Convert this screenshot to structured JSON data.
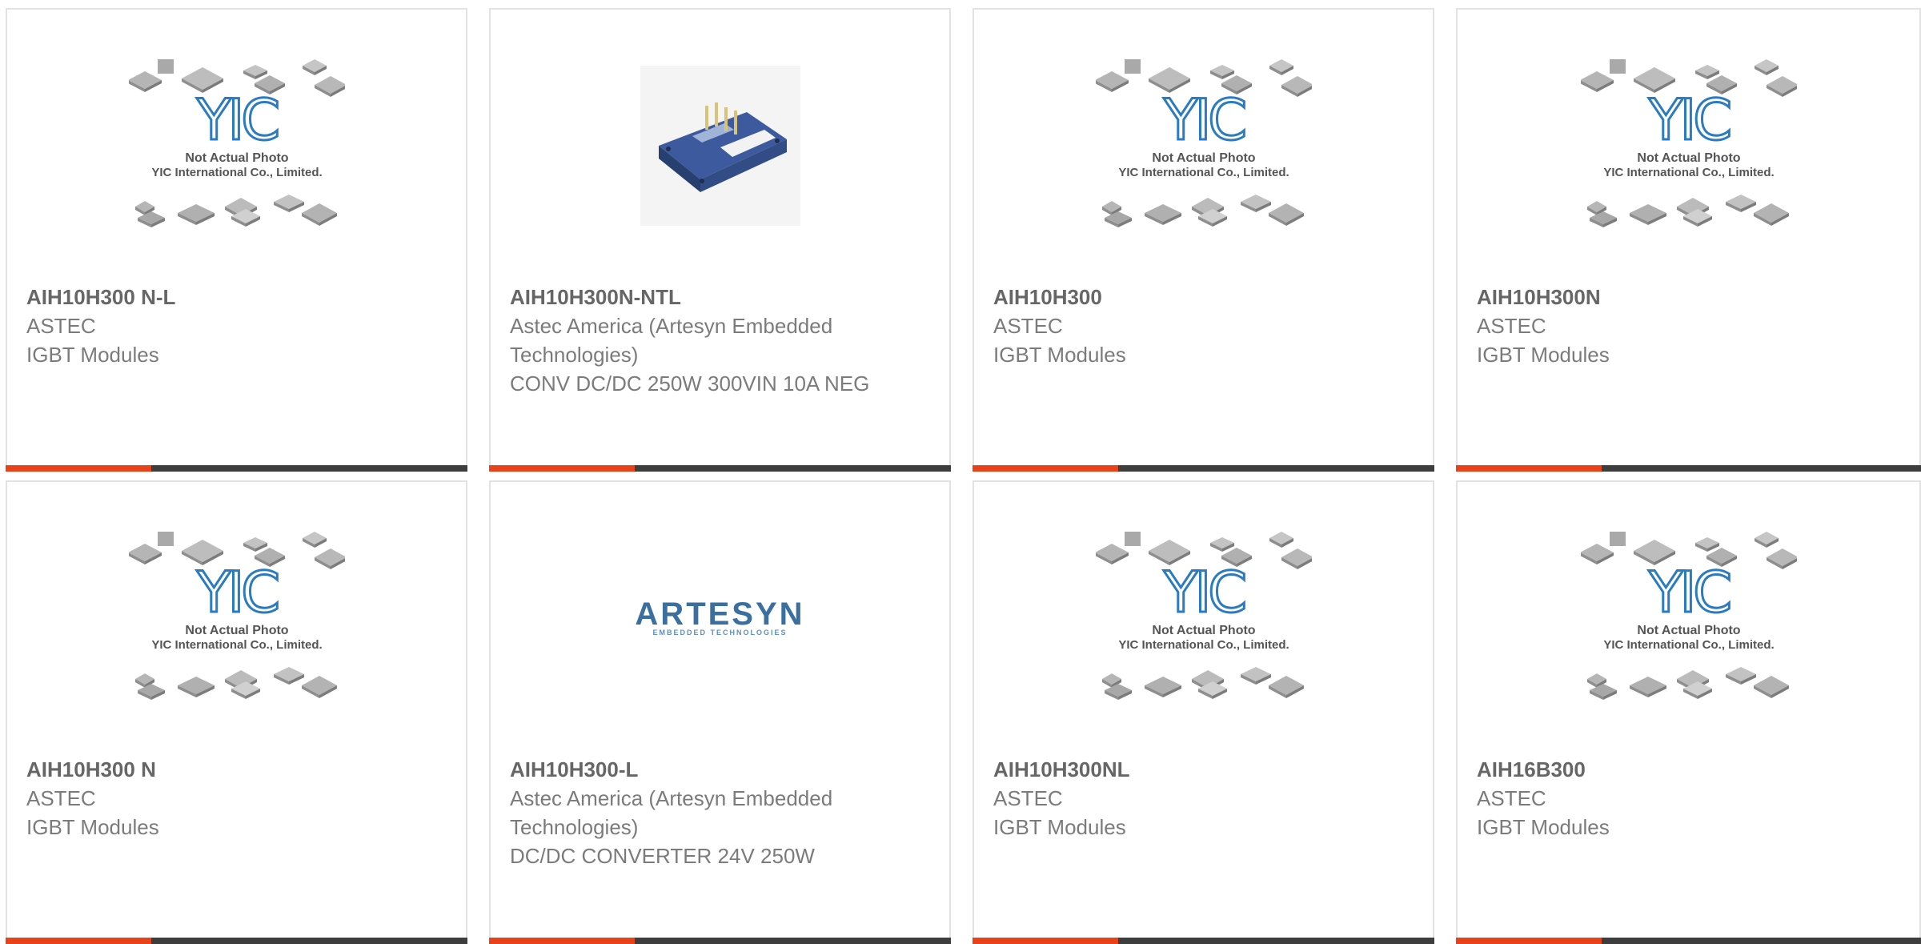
{
  "placeholder": {
    "brand": "YIC",
    "line1": "Not Actual Photo",
    "line2": "YIC International Co., Limited."
  },
  "artesyn_logo": {
    "word": "ARTESYN",
    "tagline": "EMBEDDED TECHNOLOGIES"
  },
  "colors": {
    "accent": "#e8421b",
    "bar": "#3d3d3d",
    "yic_blue": "#2a7bbf",
    "text_gray": "#7b7b7b"
  },
  "products": [
    {
      "part": "AIH10H300 N-L",
      "manufacturer": "ASTEC",
      "description": "IGBT Modules",
      "image": "placeholder"
    },
    {
      "part": "AIH10H300N-NTL",
      "manufacturer": "Astec America (Artesyn Embedded Technologies)",
      "description": "CONV DC/DC 250W 300VIN 10A NEG",
      "image": "module-photo"
    },
    {
      "part": "AIH10H300",
      "manufacturer": "ASTEC",
      "description": "IGBT Modules",
      "image": "placeholder"
    },
    {
      "part": "AIH10H300N",
      "manufacturer": "ASTEC",
      "description": "IGBT Modules",
      "image": "placeholder"
    },
    {
      "part": "AIH10H300 N",
      "manufacturer": "ASTEC",
      "description": "IGBT Modules",
      "image": "placeholder"
    },
    {
      "part": "AIH10H300-L",
      "manufacturer": "Astec America (Artesyn Embedded Technologies)",
      "description": "DC/DC CONVERTER 24V 250W",
      "image": "artesyn-logo"
    },
    {
      "part": "AIH10H300NL",
      "manufacturer": "ASTEC",
      "description": "IGBT Modules",
      "image": "placeholder"
    },
    {
      "part": "AIH16B300",
      "manufacturer": "ASTEC",
      "description": "IGBT Modules",
      "image": "placeholder"
    }
  ]
}
